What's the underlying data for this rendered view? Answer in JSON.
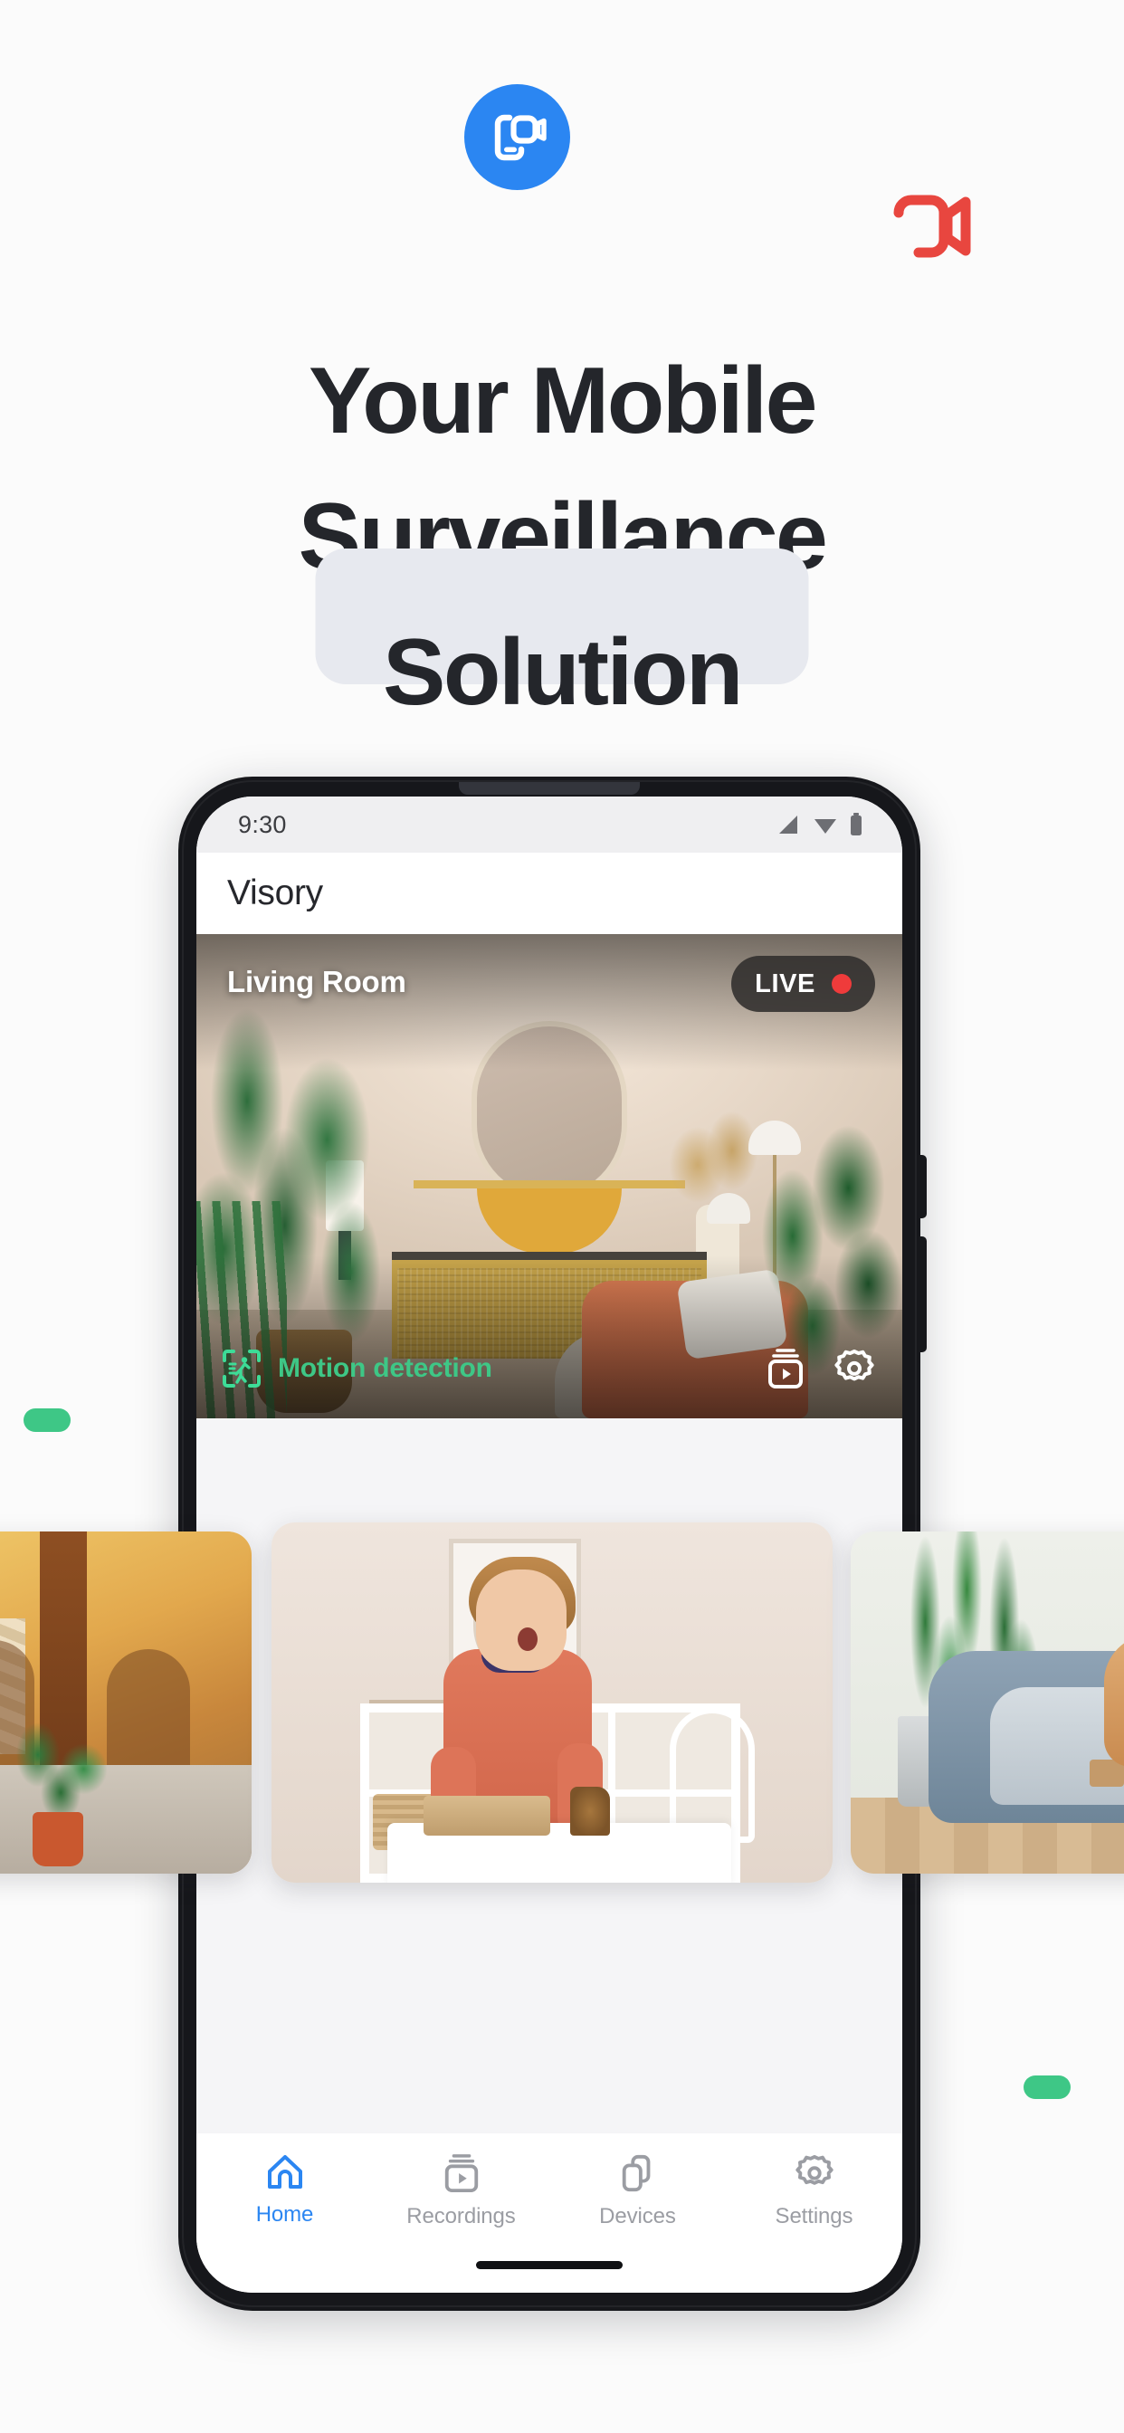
{
  "colors": {
    "brand_blue": "#2b86f2",
    "accent_green": "#3ec786",
    "live_red": "#ef3b3b",
    "red_mark": "#e8463f",
    "page_bg": "#fbfbfb",
    "highlight_bg": "#e7e9ef",
    "headline_text": "#24262b"
  },
  "logo": {
    "name": "visory-app-logo",
    "icon": "phone-video-camera-icon"
  },
  "brand_mark": {
    "name": "video-camera-outline-mark",
    "icon": "video-camera-icon"
  },
  "headline": {
    "line1": "Your Mobile",
    "line2": "Surveillance",
    "line3": "Solution"
  },
  "decor": {
    "pill_left": "green-pill",
    "pill_right": "green-pill"
  },
  "phone": {
    "statusbar": {
      "time": "9:30",
      "icons": [
        "signal-icon",
        "wifi-icon",
        "battery-icon"
      ]
    },
    "appbar": {
      "title": "Visory"
    },
    "live_feed": {
      "camera_name": "Living Room",
      "badge_label": "LIVE",
      "badge_dot": "recording-dot",
      "motion_label": "Motion detection",
      "motion_icon": "motion-detection-icon",
      "actions": [
        {
          "name": "recordings-icon",
          "label": "Recordings"
        },
        {
          "name": "settings-gear-icon",
          "label": "Settings"
        }
      ]
    },
    "carousel": [
      {
        "name": "camera-thumb-courtyard",
        "alt": "Courtyard camera"
      },
      {
        "name": "camera-thumb-playroom",
        "alt": "Playroom camera"
      },
      {
        "name": "camera-thumb-living",
        "alt": "Pet area camera"
      }
    ],
    "bottom_nav": [
      {
        "label": "Home",
        "icon": "home-icon",
        "active": true
      },
      {
        "label": "Recordings",
        "icon": "recordings-icon",
        "active": false
      },
      {
        "label": "Devices",
        "icon": "devices-icon",
        "active": false
      },
      {
        "label": "Settings",
        "icon": "settings-gear-icon",
        "active": false
      }
    ]
  }
}
